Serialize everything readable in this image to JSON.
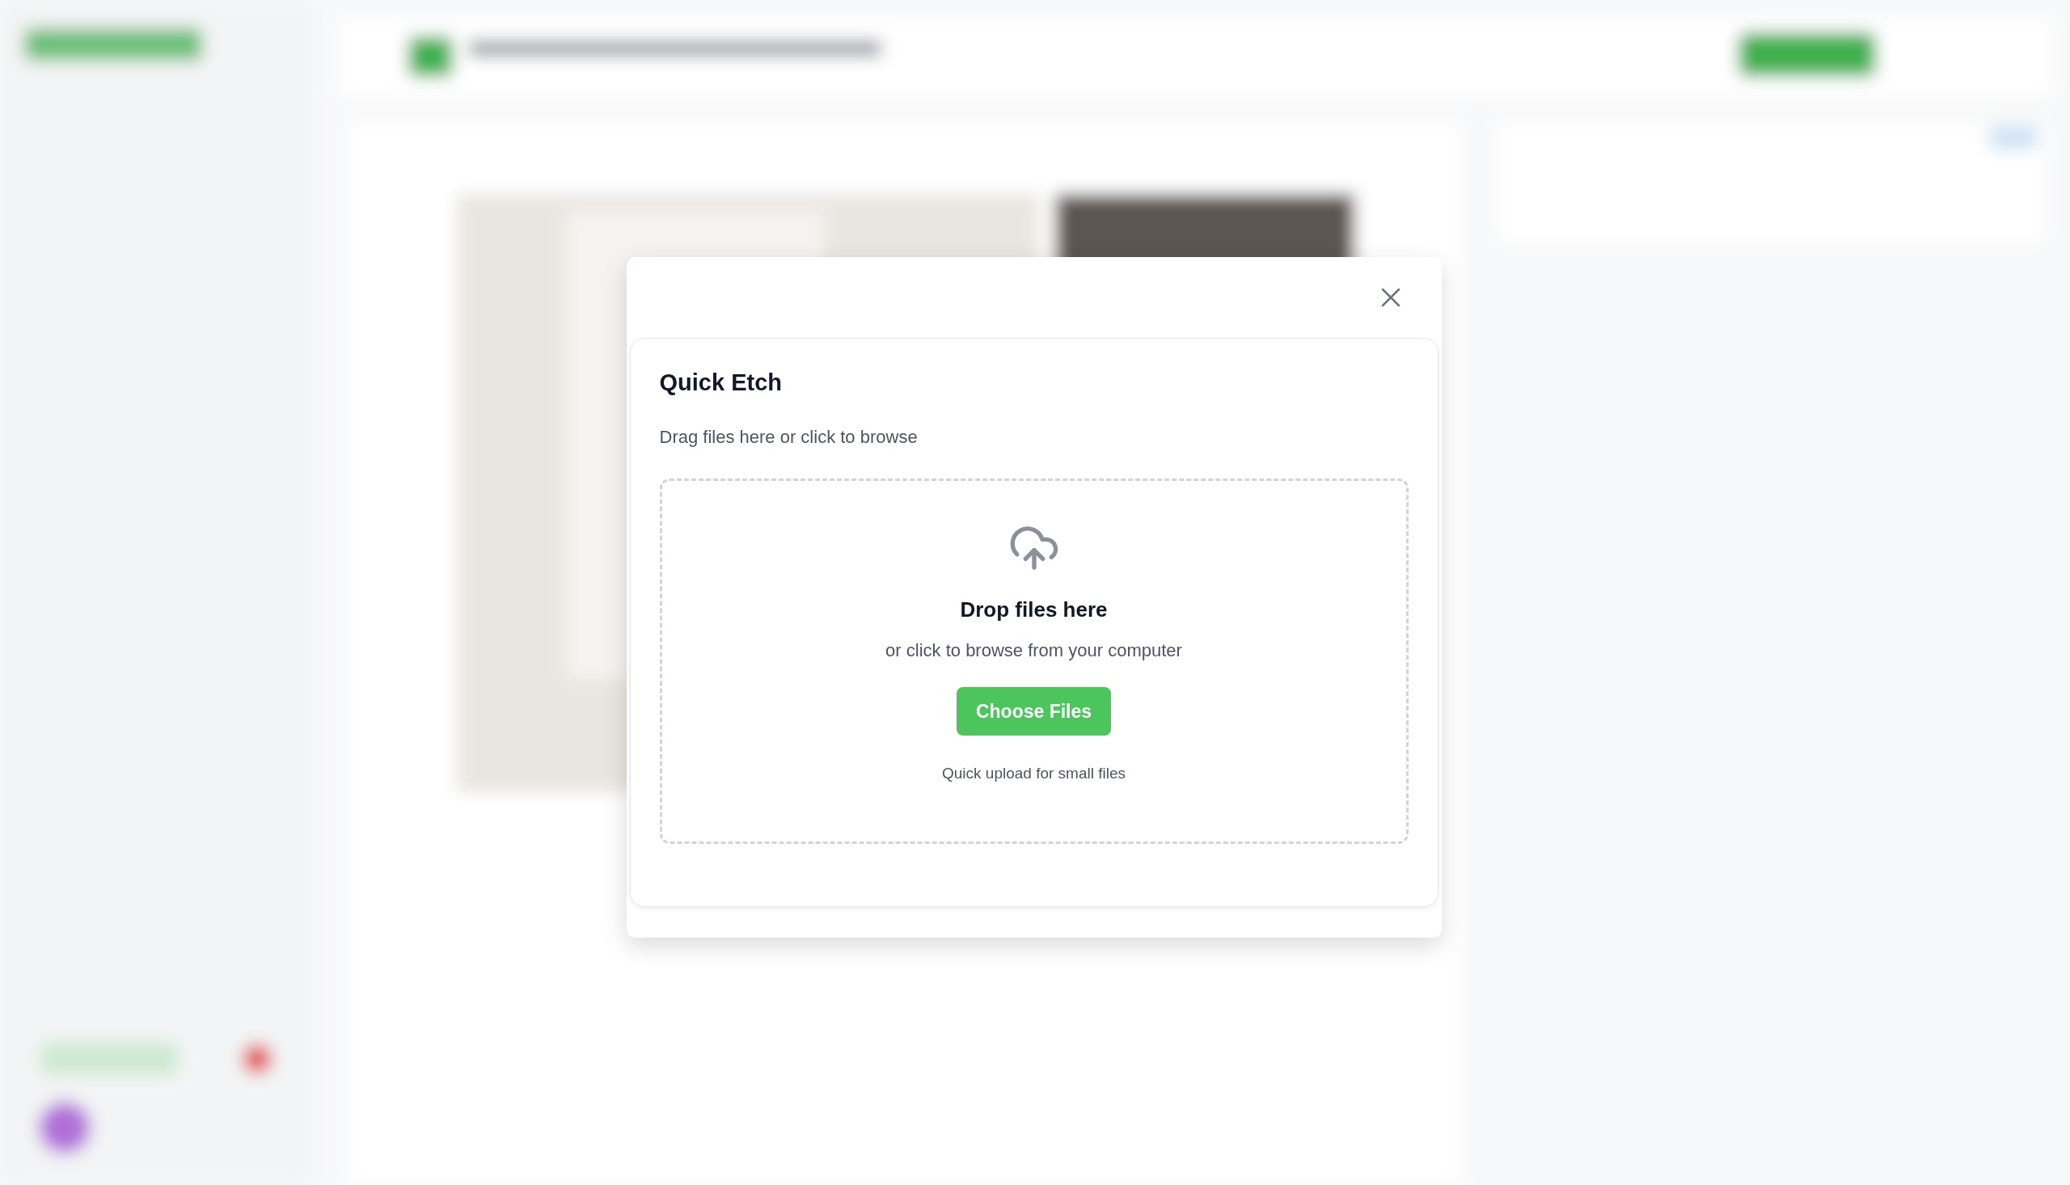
{
  "dialog": {
    "title": "Quick Etch",
    "subtitle": "Drag files here or click to browse",
    "dropzone": {
      "heading": "Drop files here",
      "text": "or click to browse from your computer",
      "button": "Choose Files",
      "hint": "Quick upload for small files"
    }
  }
}
